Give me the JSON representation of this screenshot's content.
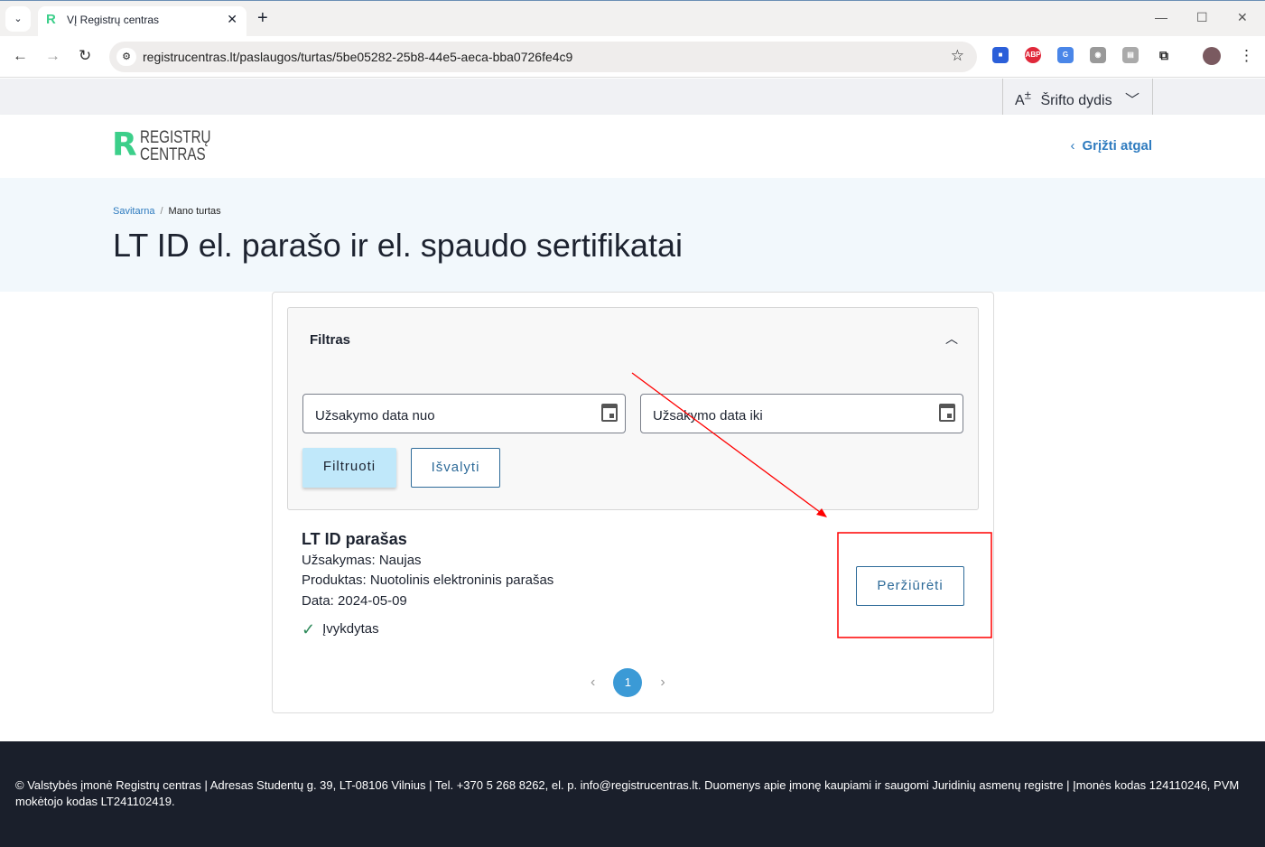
{
  "browser": {
    "tab_title": "VĮ Registrų centras",
    "url": "registrucentras.lt/paslaugos/turtas/5be05282-25b8-44e5-aeca-bba0726fe4c9"
  },
  "topbar": {
    "font_size_label": "Šrifto dydis"
  },
  "header": {
    "logo_line1": "REGISTRŲ",
    "logo_line2": "CENTRAS",
    "back_label": "Grįžti atgal"
  },
  "breadcrumb": [
    "Savitarna",
    "Mano turtas"
  ],
  "page_title": "LT ID el. parašo ir el. spaudo sertifikatai",
  "filter": {
    "title": "Filtras",
    "date_from_placeholder": "Užsakymo data nuo",
    "date_to_placeholder": "Užsakymo data iki",
    "filter_button": "Filtruoti",
    "clear_button": "Išvalyti"
  },
  "items": [
    {
      "name": "LT ID parašas",
      "order": "Užsakymas: Naujas",
      "product": "Produktas: Nuotolinis elektroninis parašas",
      "date": "Data: 2024-05-09",
      "status": "Įvykdytas",
      "view_button": "Peržiūrėti"
    }
  ],
  "pagination": {
    "current": "1"
  },
  "footer": {
    "text": "© Valstybės įmonė Registrų centras | Adresas Studentų g. 39, LT-08106 Vilnius | Tel. +370 5 268 8262, el. p. info@registrucentras.lt. Duomenys apie įmonę kaupiami ir saugomi Juridinių asmenų registre | Įmonės kodas 124110246, PVM mokėtojo kodas LT241102419."
  },
  "colors": {
    "accent": "#2e7bbf",
    "filter_button": "#c0e8fa",
    "footer": "#1a1f2b",
    "annotation": "#ff0000"
  }
}
